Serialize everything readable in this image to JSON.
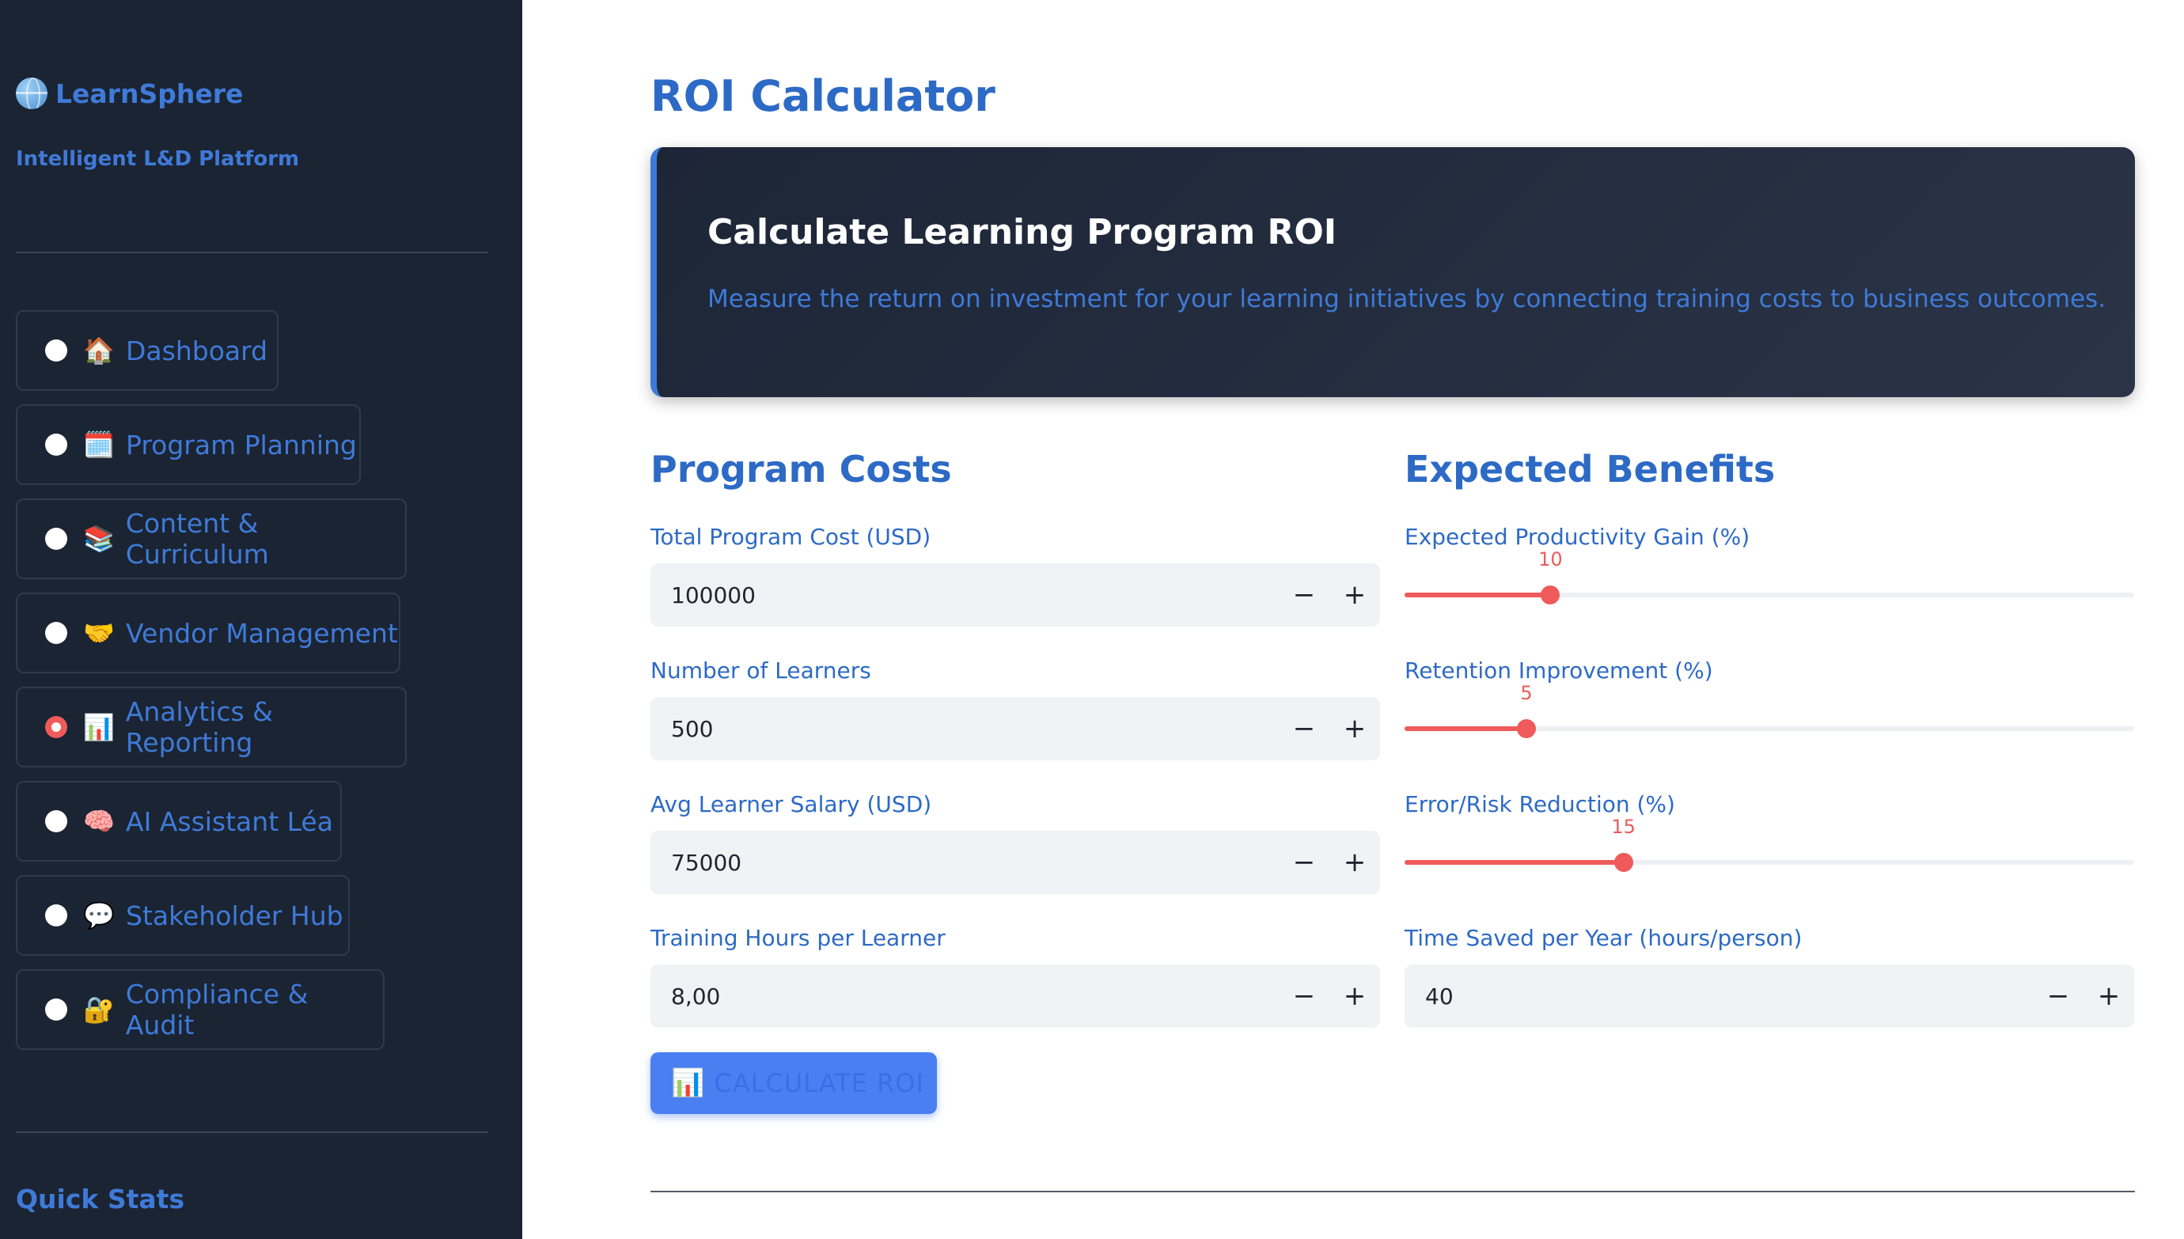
{
  "sidebar": {
    "brand": "LearnSphere",
    "tagline": "Intelligent L&D Platform",
    "items": [
      {
        "emoji": "🏠",
        "label": "Dashboard",
        "active": false
      },
      {
        "emoji": "🗓️",
        "label": "Program Planning",
        "active": false
      },
      {
        "emoji": "📚",
        "label": "Content & Curriculum",
        "active": false
      },
      {
        "emoji": "🤝",
        "label": "Vendor Management",
        "active": false
      },
      {
        "emoji": "📊",
        "label": "Analytics & Reporting",
        "active": true
      },
      {
        "emoji": "🧠",
        "label": "AI Assistant Léa",
        "active": false
      },
      {
        "emoji": "💬",
        "label": "Stakeholder Hub",
        "active": false
      },
      {
        "emoji": "🔐",
        "label": "Compliance & Audit",
        "active": false
      }
    ],
    "quick_stats": "Quick Stats"
  },
  "main": {
    "title": "ROI Calculator",
    "hero": {
      "title": "Calculate Learning Program ROI",
      "description": "Measure the return on investment for your learning initiatives by connecting training costs to business outcomes."
    },
    "costs": {
      "title": "Program Costs",
      "fields": [
        {
          "label": "Total Program Cost (USD)",
          "value": "100000"
        },
        {
          "label": "Number of Learners",
          "value": "500"
        },
        {
          "label": "Avg Learner Salary (USD)",
          "value": "75000"
        },
        {
          "label": "Training Hours per Learner",
          "value": "8,00"
        }
      ]
    },
    "benefits": {
      "title": "Expected Benefits",
      "sliders": [
        {
          "label": "Expected Productivity Gain (%)",
          "value": "10",
          "fraction": 0.2
        },
        {
          "label": "Retention Improvement (%)",
          "value": "5",
          "fraction": 0.167
        },
        {
          "label": "Error/Risk Reduction (%)",
          "value": "15",
          "fraction": 0.3
        }
      ],
      "time_saved": {
        "label": "Time Saved per Year (hours/person)",
        "value": "40"
      }
    },
    "stepper": {
      "minus": "−",
      "plus": "+"
    },
    "calculate": {
      "icon": "📊",
      "label": "CALCULATE ROI"
    }
  },
  "colors": {
    "sidebar_bg": "#1b2433",
    "accent_blue": "#2d6ac6",
    "slider_red": "#ef5a5a",
    "button_blue": "#4a7ff2"
  }
}
